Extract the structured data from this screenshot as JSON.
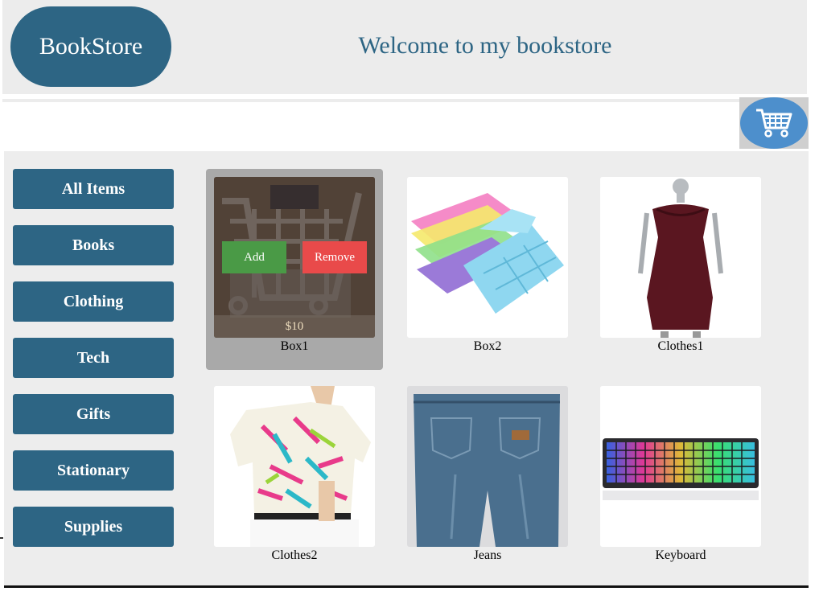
{
  "header": {
    "logo": "BookStore",
    "welcome": "Welcome to my bookstore"
  },
  "cart": {
    "icon": "shopping-cart-icon"
  },
  "sidebar": {
    "items": [
      {
        "label": "All Items"
      },
      {
        "label": "Books"
      },
      {
        "label": "Clothing"
      },
      {
        "label": "Tech"
      },
      {
        "label": "Gifts"
      },
      {
        "label": "Stationary"
      },
      {
        "label": "Supplies"
      }
    ]
  },
  "products": [
    {
      "name": "Box1",
      "price": "$10",
      "add_label": "Add",
      "remove_label": "Remove"
    },
    {
      "name": "Box2"
    },
    {
      "name": "Clothes1"
    },
    {
      "name": "Clothes2"
    },
    {
      "name": "Jeans"
    },
    {
      "name": "Keyboard"
    }
  ],
  "colors": {
    "primary": "#2d6584",
    "background": "#ececec",
    "add": "#4a9a46",
    "remove": "#e94a4a",
    "cart": "#4d8fcc"
  }
}
